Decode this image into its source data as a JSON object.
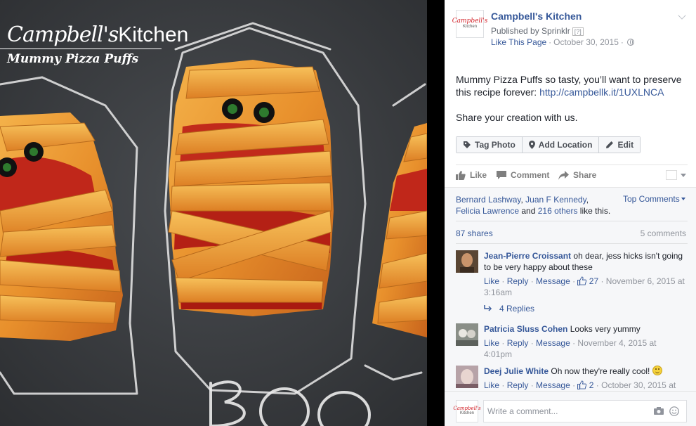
{
  "photo": {
    "brand_name": "Campbell's",
    "brand_suffix": "Kitchen",
    "title": "Mummy Pizza Puffs",
    "chalk_text": "Boo"
  },
  "post": {
    "page_name": "Campbell's Kitchen",
    "published_by": "Published by Sprinklr",
    "help_mark": "[?]",
    "like_page": "Like This Page",
    "date": "October 30, 2015",
    "separator": "·",
    "logo_text": "Campbell's",
    "logo_sub": "Kitchen",
    "message_line": "Mummy Pizza Puffs so tasty, you’ll want to preserve this recipe forever: ",
    "message_link": "http://campbellk.it/1UXLNCA",
    "message_line2": "Share your creation with us."
  },
  "photo_actions": {
    "tag": "Tag Photo",
    "location": "Add Location",
    "edit": "Edit"
  },
  "feedback": {
    "like": "Like",
    "comment": "Comment",
    "share": "Share"
  },
  "likers": {
    "name1": "Bernard Lashway",
    "sep1": ", ",
    "name2": "Juan F Kennedy",
    "sep2": ",",
    "name3": "Felicia Lawrence",
    "and": " and ",
    "others": "216 others",
    "tail": " like this."
  },
  "top_comments": "Top Comments",
  "shares": "87 shares",
  "comment_count": "5 comments",
  "comments": [
    {
      "name": "Jean-Pierre Croissant",
      "text": " oh dear, jess hicks isn't going to be very happy about these",
      "like": "Like",
      "reply": "Reply",
      "message": "Message",
      "likes": "27",
      "time": "November 6, 2015 at 3:16am",
      "replies": "4 Replies"
    },
    {
      "name": "Patricia Sluss Cohen",
      "text": " Looks very yummy",
      "like": "Like",
      "reply": "Reply",
      "message": "Message",
      "time": "November 4, 2015 at 4:01pm"
    },
    {
      "name": "Deej Julie White",
      "text": " Oh now they're really cool! ",
      "like": "Like",
      "reply": "Reply",
      "message": "Message",
      "likes": "2",
      "time": "October 30, 2015 at"
    }
  ],
  "composer": {
    "placeholder": "Write a comment..."
  },
  "colors": {
    "link": "#365899",
    "brand_red": "#d21f26",
    "slate": "#3a3d40"
  }
}
